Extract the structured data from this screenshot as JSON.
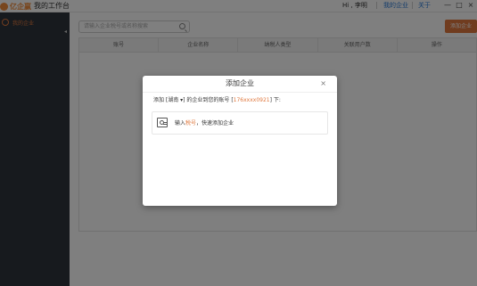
{
  "titlebar": {
    "logo_text": "亿企赢",
    "app_title": "我的工作台",
    "greeting": "Hi , 李明",
    "link_my_company": "我的企业",
    "link_about": "关于",
    "minimize": "—",
    "maximize": "□",
    "close": "×"
  },
  "sidebar": {
    "items": [
      {
        "label": "我的企业",
        "icon": "company-icon"
      }
    ],
    "collapse_glyph": "◂"
  },
  "main": {
    "search_placeholder": "请输入企业税号或名称搜索",
    "add_button": "添加企业",
    "table_headers": [
      "账号",
      "企业名称",
      "纳税人类型",
      "关联用户数",
      "操作"
    ]
  },
  "dialog": {
    "title": "添加企业",
    "close": "×",
    "message_prefix": "添加 [湖南 ▾] 的企业到您的账号 [",
    "account": "176xxxx0921",
    "message_suffix": "] 下:",
    "box_prefix": "输入",
    "box_highlight": "税号",
    "box_suffix": "，快速添加企业"
  },
  "colors": {
    "accent": "#e0793f",
    "link": "#2b7bd6",
    "sidebar_bg": "#2f343c"
  }
}
